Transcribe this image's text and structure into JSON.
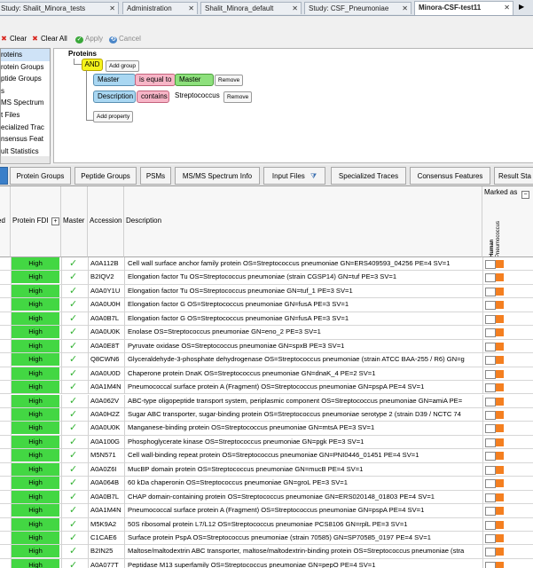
{
  "doc_tabs": [
    {
      "label": "Study: Shalit_Minora_tests",
      "active": false
    },
    {
      "label": "Administration",
      "active": false
    },
    {
      "label": "Shalit_Minora_default",
      "active": false
    },
    {
      "label": "Study: CSF_Pneumoniae",
      "active": false
    },
    {
      "label": "Minora-CSF-test11",
      "active": true
    }
  ],
  "filter_toolbar": {
    "clear": "Clear",
    "clear_all": "Clear All",
    "apply": "Apply",
    "cancel": "Cancel"
  },
  "field_list": [
    "roteins",
    "rotein Groups",
    "ptide Groups",
    "s",
    "MS Spectrum",
    "t Files",
    "ecialized Trac",
    "nsensus Feat",
    "ult Statistics"
  ],
  "query": {
    "root": "Proteins",
    "operator": "AND",
    "add_group": "Add group",
    "conditions": [
      {
        "field": "Master",
        "op": "is equal to",
        "value": "Master",
        "value_style": "pill",
        "remove": "Remove"
      },
      {
        "field": "Description",
        "op": "contains",
        "value": "Streptococcus",
        "value_style": "plain",
        "remove": "Remove"
      }
    ],
    "add_property": "Add property"
  },
  "results_tabs": [
    {
      "label": "",
      "active": true
    },
    {
      "label": "Protein Groups",
      "active": false
    },
    {
      "label": "Peptide Groups",
      "active": false
    },
    {
      "label": "PSMs",
      "active": false
    },
    {
      "label": "MS/MS Spectrum Info",
      "active": false
    },
    {
      "label": "Input Files",
      "active": false,
      "icon": "filter-icon"
    },
    {
      "label": "Specialized Traces",
      "active": false
    },
    {
      "label": "Consensus Features",
      "active": false
    },
    {
      "label": "Result Sta",
      "active": false
    }
  ],
  "grid": {
    "headers": {
      "checked": "ed",
      "fdr": "Protein FDI",
      "master": "Master",
      "accession": "Accession",
      "description": "Description",
      "marked_as": "Marked as",
      "marker_human": "Human",
      "marker_pneumo": "Pneumococcus"
    },
    "rows": [
      {
        "fdr": "High",
        "accession": "A0A112B",
        "description": "Cell wall surface anchor family protein OS=Streptococcus pneumoniae GN=ERS409593_04256 PE=4 SV=1"
      },
      {
        "fdr": "High",
        "accession": "B2IQV2",
        "description": "Elongation factor Tu OS=Streptococcus pneumoniae (strain CGSP14) GN=tuf PE=3 SV=1"
      },
      {
        "fdr": "High",
        "accession": "A0A0Y1U",
        "description": "Elongation factor Tu OS=Streptococcus pneumoniae GN=tuf_1 PE=3 SV=1"
      },
      {
        "fdr": "High",
        "accession": "A0A0U0H",
        "description": "Elongation factor G OS=Streptococcus pneumoniae GN=fusA PE=3 SV=1"
      },
      {
        "fdr": "High",
        "accession": "A0A0B7L",
        "description": "Elongation factor G OS=Streptococcus pneumoniae GN=fusA PE=3 SV=1"
      },
      {
        "fdr": "High",
        "accession": "A0A0U0K",
        "description": "Enolase OS=Streptococcus pneumoniae GN=eno_2 PE=3 SV=1"
      },
      {
        "fdr": "High",
        "accession": "A0A0E8T",
        "description": "Pyruvate oxidase OS=Streptococcus pneumoniae GN=spxB PE=3 SV=1"
      },
      {
        "fdr": "High",
        "accession": "Q8CWN6",
        "description": "Glyceraldehyde-3-phosphate dehydrogenase OS=Streptococcus pneumoniae (strain ATCC BAA-255 / R6) GN=g"
      },
      {
        "fdr": "High",
        "accession": "A0A0U0D",
        "description": "Chaperone protein DnaK OS=Streptococcus pneumoniae GN=dnaK_4 PE=2 SV=1"
      },
      {
        "fdr": "High",
        "accession": "A0A1M4N",
        "description": "Pneumococcal surface protein A (Fragment) OS=Streptococcus pneumoniae GN=pspA PE=4 SV=1"
      },
      {
        "fdr": "High",
        "accession": "A0A062V",
        "description": "ABC-type oligopeptide transport system, periplasmic component OS=Streptococcus pneumoniae GN=amiA PE="
      },
      {
        "fdr": "High",
        "accession": "A0A0H2Z",
        "description": "Sugar ABC transporter, sugar-binding protein OS=Streptococcus pneumoniae serotype 2 (strain D39 / NCTC 74"
      },
      {
        "fdr": "High",
        "accession": "A0A0U0K",
        "description": "Manganese-binding protein OS=Streptococcus pneumoniae GN=mtsA PE=3 SV=1"
      },
      {
        "fdr": "High",
        "accession": "A0A100G",
        "description": "Phosphoglycerate kinase OS=Streptococcus pneumoniae GN=pgk PE=3 SV=1"
      },
      {
        "fdr": "High",
        "accession": "M5N571",
        "description": "Cell wall-binding repeat protein OS=Streptococcus pneumoniae GN=PNI0446_01451 PE=4 SV=1"
      },
      {
        "fdr": "High",
        "accession": "A0A0Z6I",
        "description": "MucBP domain protein OS=Streptococcus pneumoniae GN=mucB PE=4 SV=1"
      },
      {
        "fdr": "High",
        "accession": "A0A064B",
        "description": "60 kDa chaperonin OS=Streptococcus pneumoniae GN=groL PE=3 SV=1"
      },
      {
        "fdr": "High",
        "accession": "A0A0B7L",
        "description": "CHAP domain-containing protein OS=Streptococcus pneumoniae GN=ERS020148_01803 PE=4 SV=1"
      },
      {
        "fdr": "High",
        "accession": "A0A1M4N",
        "description": "Pneumococcal surface protein A (Fragment) OS=Streptococcus pneumoniae GN=pspA PE=4 SV=1"
      },
      {
        "fdr": "High",
        "accession": "M5K9A2",
        "description": "50S ribosomal protein L7/L12 OS=Streptococcus pneumoniae PCS8106 GN=rplL PE=3 SV=1"
      },
      {
        "fdr": "High",
        "accession": "C1CAE6",
        "description": "Surface protein PspA OS=Streptococcus pneumoniae (strain 70585) GN=SP70585_0197 PE=4 SV=1"
      },
      {
        "fdr": "High",
        "accession": "B2IN25",
        "description": "Maltose/maltodextrin ABC transporter, maltose/maltodextrin-binding protein OS=Streptococcus pneumoniae (stra"
      },
      {
        "fdr": "High",
        "accession": "A0A077T",
        "description": "Peptidase M13 superfamily OS=Streptococcus pneumoniae GN=pepO PE=4 SV=1"
      }
    ]
  },
  "colors": {
    "fdr_high": "#43d743",
    "marker_orange": "#f47f20",
    "and_yellow": "#f5f31c",
    "active_tab_blue": "#3a7fc9"
  }
}
